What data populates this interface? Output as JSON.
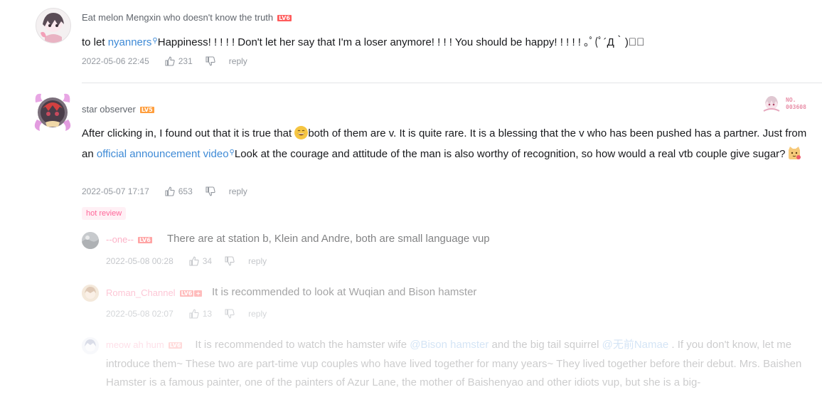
{
  "comments": [
    {
      "username": "Eat melon Mengxin who doesn't know the truth",
      "level": "LV6",
      "text_before": "to let ",
      "link_text": "nyanners",
      "text_after": "Happiness! ! ! ! ! Don't let her say that I'm a loser anymore! ! ! ! You should be happy! ! ! ! ! ｡ﾟ(ﾟ´Д｀)ﾟ｡",
      "date": "2022-05-06 22:45",
      "likes": "231",
      "reply_label": "reply"
    },
    {
      "username": "star observer",
      "level": "LV5",
      "badge_line1": "NO.",
      "badge_line2": "003608",
      "text_part1": "After clicking in, I found out that it is true that",
      "text_part2": "both of them are v. It is quite rare. It is a blessing that the v who has been pushed has a partner. Just from an ",
      "link_text": "official announcement video",
      "text_part3": "Look at the courage and attitude of the man is also worthy of recognition, so how would a real vtb couple give sugar?",
      "date": "2022-05-07 17:17",
      "likes": "653",
      "reply_label": "reply",
      "hot_label": "hot review",
      "replies": [
        {
          "username": "--one--",
          "level": "LV6",
          "text": "There are at station b, Klein and Andre, both are small language vup",
          "date": "2022-05-08 00:28",
          "likes": "34",
          "reply_label": "reply"
        },
        {
          "username": "Roman_Channel",
          "level": "LV6",
          "text": "It is recommended to look at Wuqian and Bison hamster",
          "date": "2022-05-08 02:07",
          "likes": "13",
          "reply_label": "reply"
        },
        {
          "username": "meow ah hum",
          "level": "LV6",
          "text_part1": "It is recommended to watch the hamster wife ",
          "mention1": "@Bison hamster",
          "text_part2": " and the big tail squirrel ",
          "mention2": "@无前Namae",
          "text_part3": " . If you don't know, let me introduce them~ These two are part-time vup couples who have lived together for many years~ They lived together before their debut. Mrs. Baishen Hamster is a famous painter, one of the painters of Azur Lane, the mother of Baishenyao and other idiots vup, but she is a big-"
        }
      ]
    }
  ],
  "colors": {
    "link": "#3e8ad6",
    "meta": "#9499a0",
    "level6": "#ff5b5b",
    "level5": "#ff9e3d",
    "hot": "#ff6699",
    "pink_name": "#fb7299"
  }
}
